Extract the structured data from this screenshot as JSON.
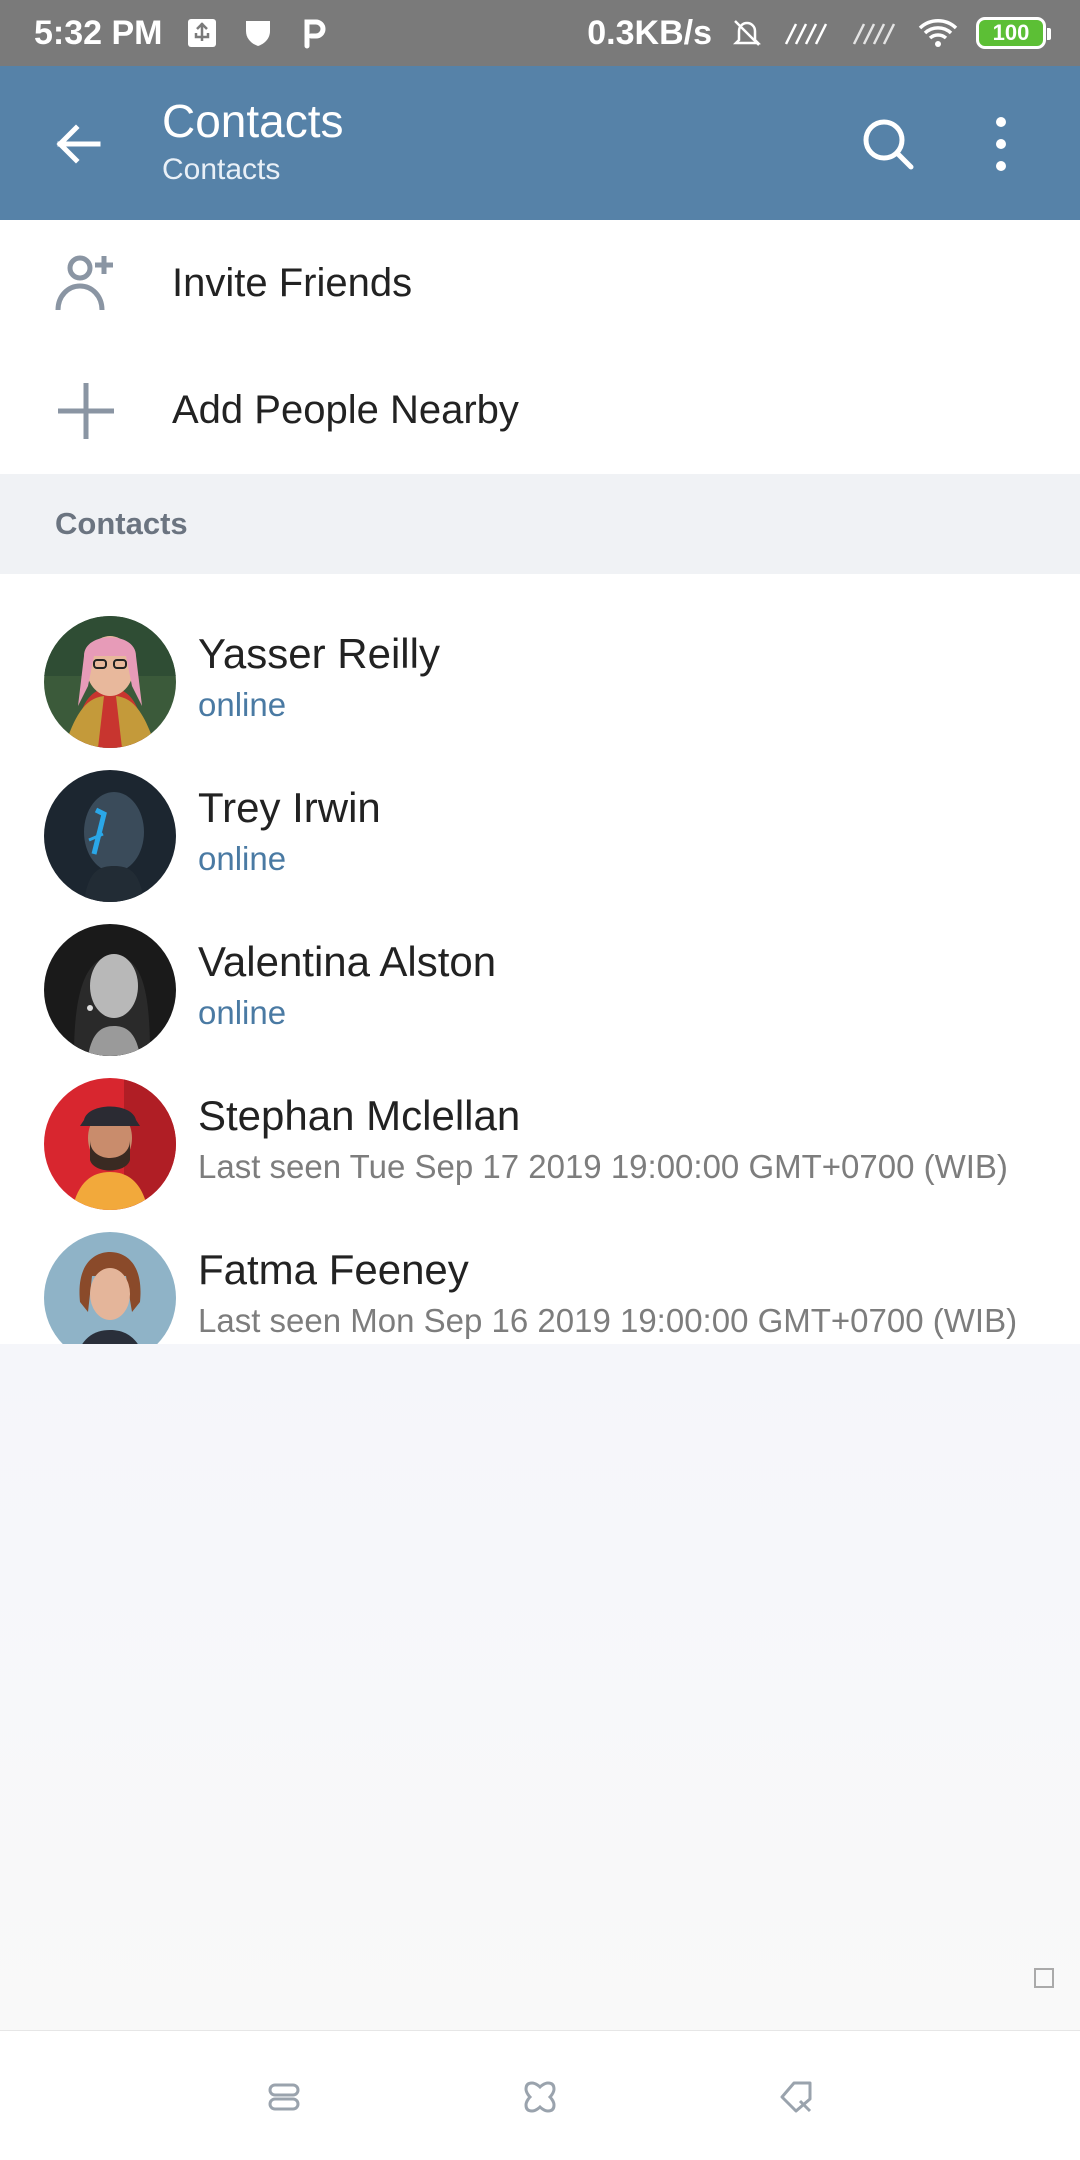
{
  "status_bar": {
    "time": "5:32 PM",
    "network_speed": "0.3KB/s",
    "battery_level": "100",
    "icons": [
      "usb-icon",
      "shield-icon",
      "parking-icon",
      "mute-bell-icon",
      "signal-icon",
      "signal-icon",
      "wifi-icon",
      "battery-icon"
    ]
  },
  "app_bar": {
    "title": "Contacts",
    "subtitle": "Contacts",
    "color": "#5682a8"
  },
  "actions": [
    {
      "label": "Invite Friends",
      "icon": "add-person-icon"
    },
    {
      "label": "Add People Nearby",
      "icon": "plus-icon"
    }
  ],
  "section_header": "Contacts",
  "contacts": [
    {
      "name": "Yasser Reilly",
      "status": "online",
      "online": true
    },
    {
      "name": "Trey Irwin",
      "status": "online",
      "online": true
    },
    {
      "name": "Valentina Alston",
      "status": "online",
      "online": true
    },
    {
      "name": "Stephan Mclellan",
      "status": "Last seen Tue Sep 17 2019 19:00:00 GMT+0700 (WIB)",
      "online": false
    },
    {
      "name": "Fatma Feeney",
      "status": "Last seen Mon Sep 16 2019 19:00:00 GMT+0700 (WIB)",
      "online": false
    }
  ],
  "colors": {
    "accent": "#5682a8",
    "online_text": "#4a7aa3",
    "offline_text": "#7d7d7d"
  }
}
